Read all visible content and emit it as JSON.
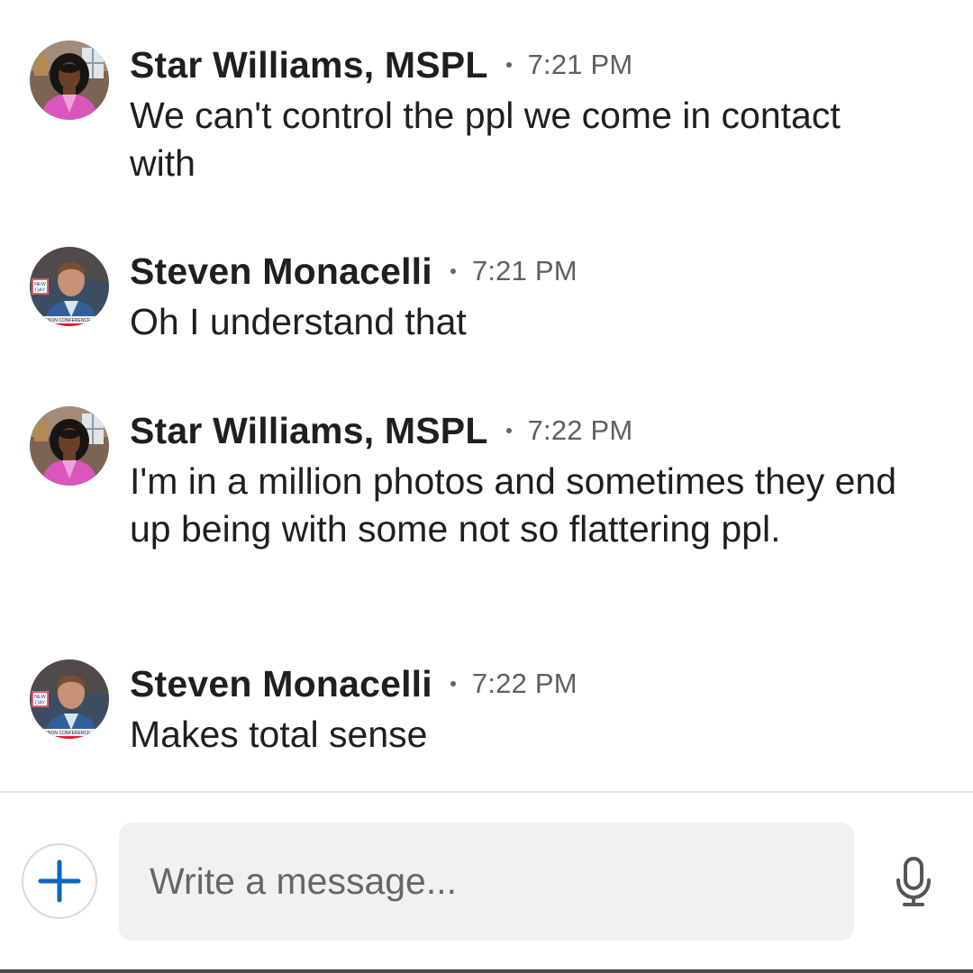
{
  "conversation": {
    "messages": [
      {
        "sender": "Star Williams, MSPL",
        "time": "7:21 PM",
        "text": "We can't control the ppl we come in contact with",
        "avatar": "woman-in-pink-avatar"
      },
      {
        "sender": "Steven Monacelli",
        "time": "7:21 PM",
        "text": "Oh I understand that",
        "avatar": "man-on-tv-avatar",
        "avatar_text": {
          "badge": "NEW DAY",
          "ticker": "ANON CONFERENCE"
        }
      },
      {
        "sender": "Star Williams, MSPL",
        "time": "7:22 PM",
        "text": "I'm in a million photos and sometimes they end up being with some not so flattering ppl.",
        "avatar": "woman-in-pink-avatar"
      },
      {
        "sender": "Steven Monacelli",
        "time": "7:22 PM",
        "text": "Makes total sense",
        "avatar": "man-on-tv-avatar",
        "avatar_text": {
          "badge": "NEW DAY",
          "ticker": "ANON CONFERENCE"
        }
      }
    ]
  },
  "composer": {
    "placeholder": "Write a message...",
    "add_icon": "plus-icon",
    "mic_icon": "microphone-icon"
  },
  "colors": {
    "accent": "#0a66c2",
    "input_background": "#f1f1ef",
    "divider": "#e3e3e3",
    "secondary_text": "#5f5f5f"
  }
}
